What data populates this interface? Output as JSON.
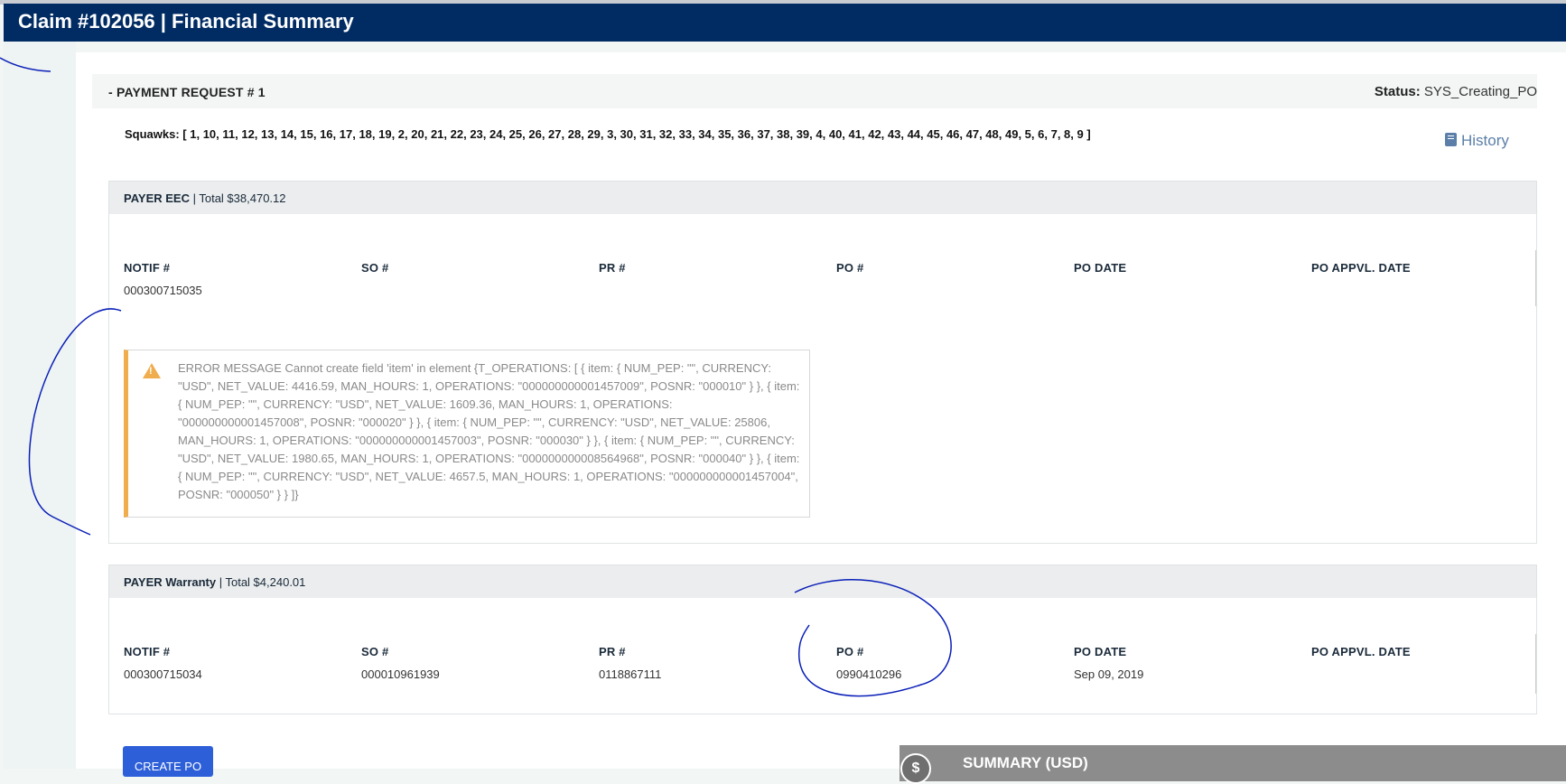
{
  "header": {
    "title": "Claim #102056 | Financial Summary"
  },
  "payment_request": {
    "title": "- PAYMENT REQUEST # 1",
    "status_label": "Status:",
    "status_value": "SYS_Creating_PO",
    "squawks": "Squawks: [ 1, 10, 11, 12, 13, 14, 15, 16, 17, 18, 19, 2, 20, 21, 22, 23, 24, 25, 26, 27, 28, 29, 3, 30, 31, 32, 33, 34, 35, 36, 37, 38, 39, 4, 40, 41, 42, 43, 44, 45, 46, 47, 48, 49, 5, 6, 7, 8, 9 ]",
    "history_label": "History"
  },
  "columns": [
    "NOTIF #",
    "SO #",
    "PR #",
    "PO #",
    "PO DATE",
    "PO APPVL. DATE"
  ],
  "payers": [
    {
      "name": "PAYER EEC",
      "total": "| Total $38,470.12",
      "values": [
        "000300715035",
        "",
        "",
        "",
        "",
        ""
      ],
      "error": "ERROR MESSAGE Cannot create field 'item' in element {T_OPERATIONS: [ { item: { NUM_PEP: \"\", CURRENCY: \"USD\", NET_VALUE: 4416.59, MAN_HOURS: 1, OPERATIONS: \"000000000001457009\", POSNR: \"000010\" } }, { item: { NUM_PEP: \"\", CURRENCY: \"USD\", NET_VALUE: 1609.36, MAN_HOURS: 1, OPERATIONS: \"000000000001457008\", POSNR: \"000020\" } }, { item: { NUM_PEP: \"\", CURRENCY: \"USD\", NET_VALUE: 25806, MAN_HOURS: 1, OPERATIONS: \"000000000001457003\", POSNR: \"000030\" } }, { item: { NUM_PEP: \"\", CURRENCY: \"USD\", NET_VALUE: 1980.65, MAN_HOURS: 1, OPERATIONS: \"000000000008564968\", POSNR: \"000040\" } }, { item: { NUM_PEP: \"\", CURRENCY: \"USD\", NET_VALUE: 4657.5, MAN_HOURS: 1, OPERATIONS: \"000000000001457004\", POSNR: \"000050\" } } ]}"
    },
    {
      "name": "PAYER Warranty",
      "total": "| Total $4,240.01",
      "values": [
        "000300715034",
        "000010961939",
        "0118867111",
        "0990410296",
        "Sep 09, 2019",
        ""
      ]
    }
  ],
  "actions": {
    "create_po": "CREATE PO"
  },
  "summary": {
    "icon": "$",
    "title": "SUMMARY (USD)"
  },
  "icons": {
    "history": "book-icon",
    "warning": "warning-triangle-icon",
    "summary": "dollar-circle-icon"
  },
  "colors": {
    "header_bg": "#002b63",
    "warning": "#f0ad4e",
    "button": "#2d5fd8",
    "annotation_ink": "#0a1fb8"
  }
}
